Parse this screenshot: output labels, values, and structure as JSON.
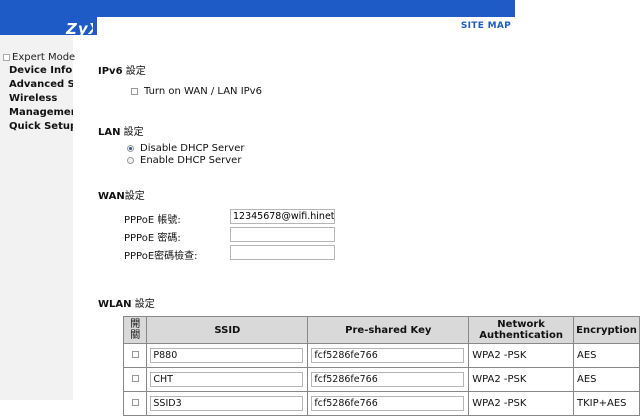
{
  "header": {
    "logo": "ZyX",
    "site_map": "SITE MAP"
  },
  "sidebar": {
    "mode_label": "Expert Mode",
    "items": [
      {
        "label": "Device Info"
      },
      {
        "label": "Advanced Setup"
      },
      {
        "label": "Wireless"
      },
      {
        "label": "Management"
      },
      {
        "label": "Quick Setup"
      }
    ]
  },
  "ipv6": {
    "title": "IPv6",
    "title_zh": " 設定",
    "toggle_label": "Turn on WAN / LAN IPv6",
    "toggle_checked": false
  },
  "lan": {
    "title": "LAN",
    "title_zh": " 設定",
    "options": [
      {
        "label": "Disable DHCP Server",
        "selected": true
      },
      {
        "label": "Enable DHCP Server",
        "selected": false
      }
    ]
  },
  "wan": {
    "title": "WAN",
    "title_zh": "設定",
    "fields": [
      {
        "label": "PPPoE 帳號:",
        "value": "12345678@wifi.hinet.net"
      },
      {
        "label": "PPPoE 密碼:",
        "value": ""
      },
      {
        "label": "PPPoE密碼檢查:",
        "value": ""
      }
    ]
  },
  "wlan": {
    "title": "WLAN",
    "title_zh": " 設定",
    "columns": [
      "開關",
      "SSID",
      "Pre-shared Key",
      "Network Authentication",
      "Encryption"
    ],
    "rows": [
      {
        "ssid": "P880",
        "key": "fcf5286fe766",
        "auth": "WPA2 -PSK",
        "enc": "AES"
      },
      {
        "ssid": "CHT",
        "key": "fcf5286fe766",
        "auth": "WPA2 -PSK",
        "enc": "AES"
      },
      {
        "ssid": "SSID3",
        "key": "fcf5286fe766",
        "auth": "WPA2 -PSK",
        "enc": "TKIP+AES"
      }
    ]
  },
  "colors": {
    "banner_blue": "#1e5bc6",
    "sidebar_bg": "#f2f2f2",
    "table_header_bg": "#d9d9d9"
  }
}
